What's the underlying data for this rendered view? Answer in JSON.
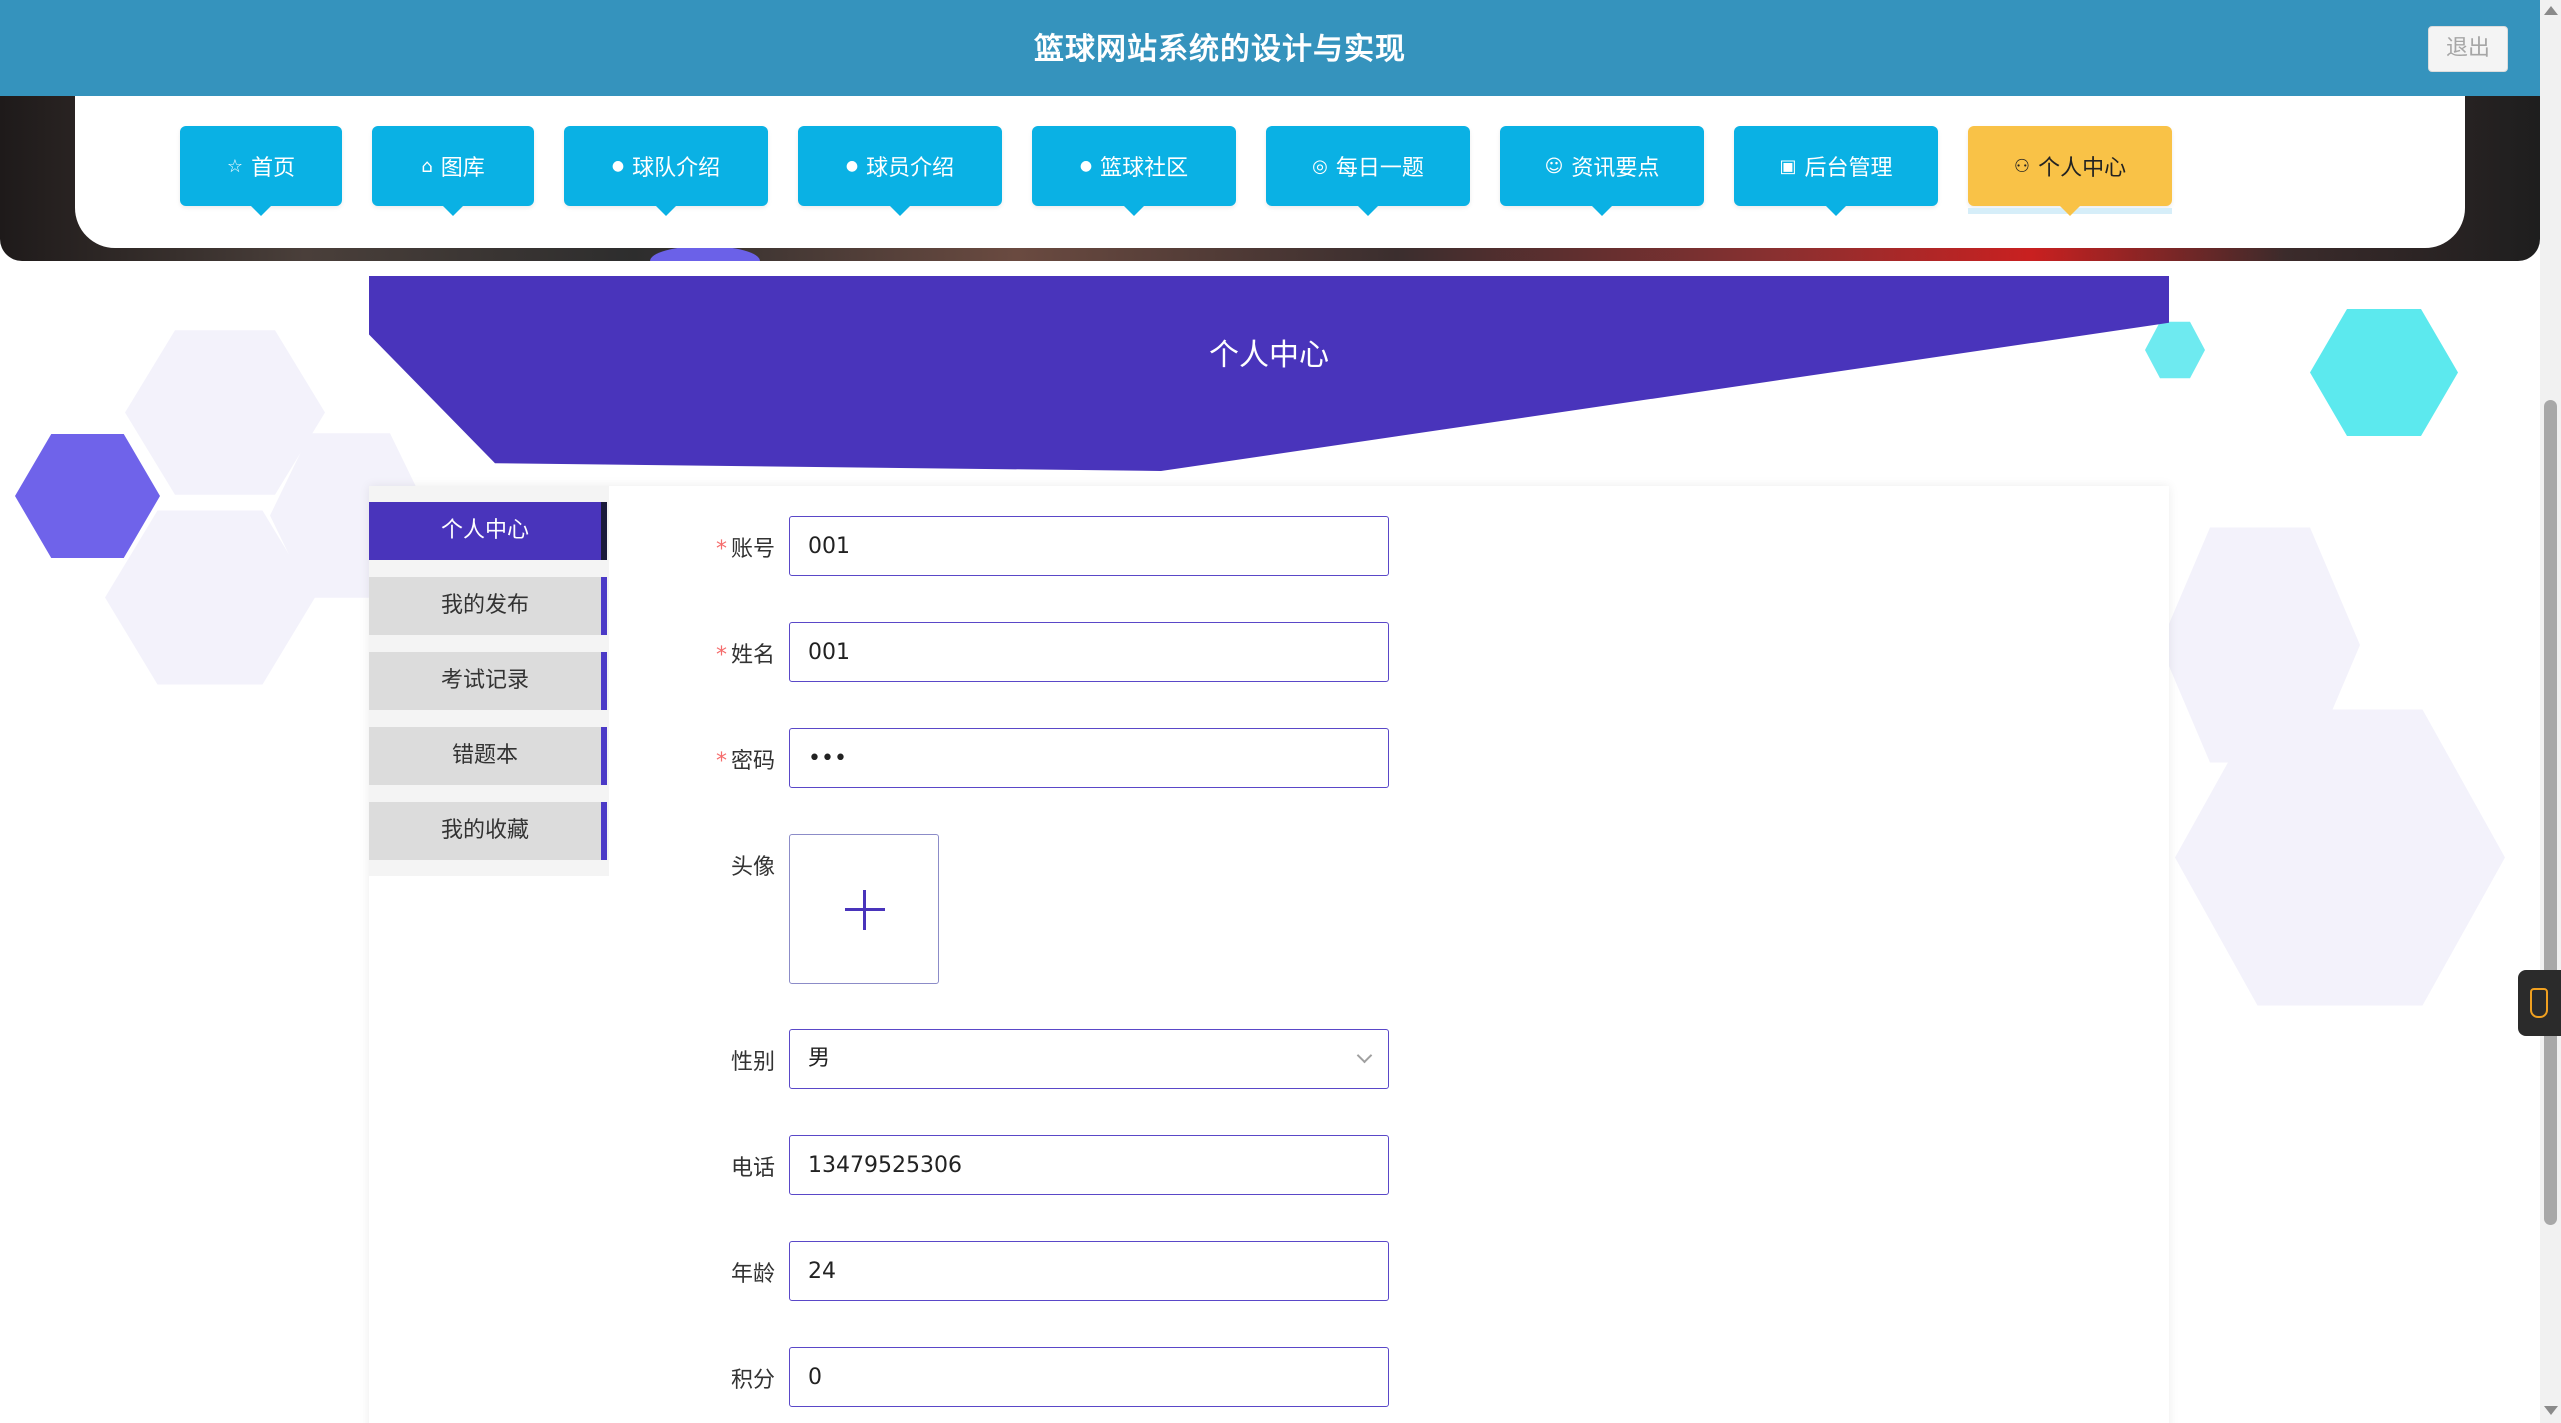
{
  "header": {
    "site_title": "篮球网站系统的设计与实现",
    "logout_label": "退出"
  },
  "nav": {
    "items": [
      {
        "label": "首页",
        "icon": "star-outline-icon",
        "glyph": "☆",
        "active": false
      },
      {
        "label": "图库",
        "icon": "bag-icon",
        "glyph": "⌂",
        "active": false
      },
      {
        "label": "球队介绍",
        "icon": "info-circle-icon",
        "glyph": "●",
        "active": false
      },
      {
        "label": "球员介绍",
        "icon": "question-circle-icon",
        "glyph": "●",
        "active": false
      },
      {
        "label": "篮球社区",
        "icon": "info-circle-icon",
        "glyph": "●",
        "active": false
      },
      {
        "label": "每日一题",
        "icon": "basketball-icon",
        "glyph": "◎",
        "active": false
      },
      {
        "label": "资讯要点",
        "icon": "smile-circle-icon",
        "glyph": "☺",
        "active": false
      },
      {
        "label": "后台管理",
        "icon": "gift-box-icon",
        "glyph": "▣",
        "active": false
      },
      {
        "label": "个人中心",
        "icon": "user-icon",
        "glyph": "⚇",
        "active": true
      }
    ]
  },
  "page": {
    "title": "个人中心"
  },
  "sidebar": {
    "items": [
      {
        "label": "个人中心",
        "active": true
      },
      {
        "label": "我的发布",
        "active": false
      },
      {
        "label": "考试记录",
        "active": false
      },
      {
        "label": "错题本",
        "active": false
      },
      {
        "label": "我的收藏",
        "active": false
      }
    ]
  },
  "form": {
    "account": {
      "label": "账号",
      "value": "001",
      "required": true
    },
    "name": {
      "label": "姓名",
      "value": "001",
      "required": true
    },
    "password": {
      "label": "密码",
      "value": "•••",
      "required": true
    },
    "avatar": {
      "label": "头像"
    },
    "gender": {
      "label": "性别",
      "value": "男"
    },
    "phone": {
      "label": "电话",
      "value": "13479525306"
    },
    "age": {
      "label": "年龄",
      "value": "24"
    },
    "points": {
      "label": "积分",
      "value": "0"
    }
  },
  "colors": {
    "topbar": "#3593bd",
    "nav_item": "#0ab1e4",
    "nav_active": "#f9c247",
    "header_purple": "#4934bb",
    "required_star": "#f56c6c"
  }
}
